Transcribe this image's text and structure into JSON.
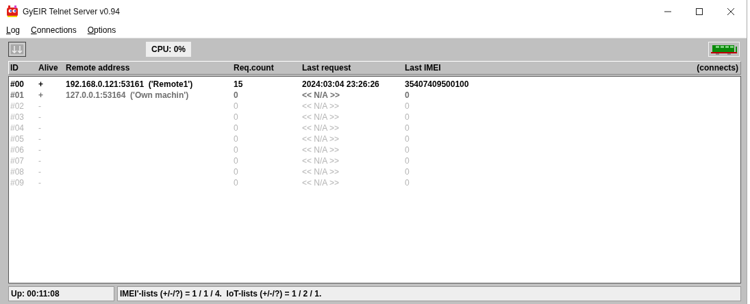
{
  "window": {
    "title": "GyEIR Telnet Server  v0.94"
  },
  "menu": [
    {
      "label": "Log"
    },
    {
      "label": "Connections"
    },
    {
      "label": "Options"
    }
  ],
  "toolbar": {
    "cpu": "CPU:  0%"
  },
  "table": {
    "columns": [
      "ID",
      "Alive",
      "Remote address",
      "Req.count",
      "Last request",
      "Last IMEI",
      "(connects)"
    ],
    "rows": [
      {
        "kind": "active",
        "cells": [
          "#00",
          "+",
          "192.168.0.121:53161  ('Remote1')",
          "15",
          "2024:03:04 23:26:26",
          "35407409500100"
        ]
      },
      {
        "kind": "idle",
        "cells": [
          "#01",
          "+",
          "127.0.0.1:53164  ('Own machin')",
          "0",
          "<< N/A >>",
          "0"
        ]
      },
      {
        "kind": "free",
        "cells": [
          "#02",
          "-",
          "",
          "0",
          "<< N/A >>",
          "0"
        ]
      },
      {
        "kind": "free",
        "cells": [
          "#03",
          "-",
          "",
          "0",
          "<< N/A >>",
          "0"
        ]
      },
      {
        "kind": "free",
        "cells": [
          "#04",
          "-",
          "",
          "0",
          "<< N/A >>",
          "0"
        ]
      },
      {
        "kind": "free",
        "cells": [
          "#05",
          "-",
          "",
          "0",
          "<< N/A >>",
          "0"
        ]
      },
      {
        "kind": "free",
        "cells": [
          "#06",
          "-",
          "",
          "0",
          "<< N/A >>",
          "0"
        ]
      },
      {
        "kind": "free",
        "cells": [
          "#07",
          "-",
          "",
          "0",
          "<< N/A >>",
          "0"
        ]
      },
      {
        "kind": "free",
        "cells": [
          "#08",
          "-",
          "",
          "0",
          "<< N/A >>",
          "0"
        ]
      },
      {
        "kind": "free",
        "cells": [
          "#09",
          "-",
          "",
          "0",
          "<< N/A >>",
          "0"
        ]
      }
    ]
  },
  "status_bar": {
    "uptime": "Up: 00:11:08",
    "lists": "IMEI'-lists (+/-/?) = 1 / 1 / 4.  IoT-lists (+/-/?) = 1 / 2 / 1."
  }
}
